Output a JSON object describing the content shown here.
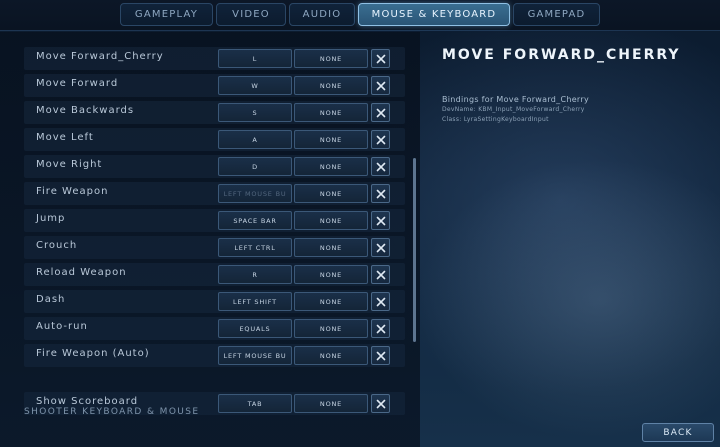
{
  "tabs": [
    {
      "label": "GAMEPLAY"
    },
    {
      "label": "VIDEO"
    },
    {
      "label": "AUDIO"
    },
    {
      "label": "MOUSE & KEYBOARD"
    },
    {
      "label": "GAMEPAD"
    }
  ],
  "active_tab": "MOUSE & KEYBOARD",
  "bindings": [
    {
      "label": "Move Forward_Cherry",
      "primary": "L",
      "secondary": "NONE"
    },
    {
      "label": "Move Forward",
      "primary": "W",
      "secondary": "NONE"
    },
    {
      "label": "Move Backwards",
      "primary": "S",
      "secondary": "NONE"
    },
    {
      "label": "Move Left",
      "primary": "A",
      "secondary": "NONE"
    },
    {
      "label": "Move Right",
      "primary": "D",
      "secondary": "NONE"
    },
    {
      "label": "Fire Weapon",
      "primary": "LEFT MOUSE BU",
      "secondary": "NONE"
    },
    {
      "label": "Jump",
      "primary": "SPACE BAR",
      "secondary": "NONE"
    },
    {
      "label": "Crouch",
      "primary": "LEFT CTRL",
      "secondary": "NONE"
    },
    {
      "label": "Reload Weapon",
      "primary": "R",
      "secondary": "NONE"
    },
    {
      "label": "Dash",
      "primary": "LEFT SHIFT",
      "secondary": "NONE"
    },
    {
      "label": "Auto-run",
      "primary": "EQUALS",
      "secondary": "NONE"
    },
    {
      "label": "Fire Weapon (Auto)",
      "primary": "LEFT MOUSE BU",
      "secondary": "NONE"
    }
  ],
  "section": {
    "header": "SHOOTER KEYBOARD & MOUSE"
  },
  "section_bindings": [
    {
      "label": "Show Scoreboard",
      "primary": "TAB",
      "secondary": "NONE"
    }
  ],
  "detail": {
    "title": "MOVE FORWARD_CHERRY",
    "description": "Bindings for Move Forward_Cherry",
    "devname": "DevName: KBM_Input_MoveForward_Cherry",
    "class": "Class: LyraSettingKeyboardInput"
  },
  "footer": {
    "back_label": "BACK"
  },
  "colors": {
    "accent": "#8fc0e4",
    "panel": "#0b1828",
    "text": "#c9d6e4"
  }
}
